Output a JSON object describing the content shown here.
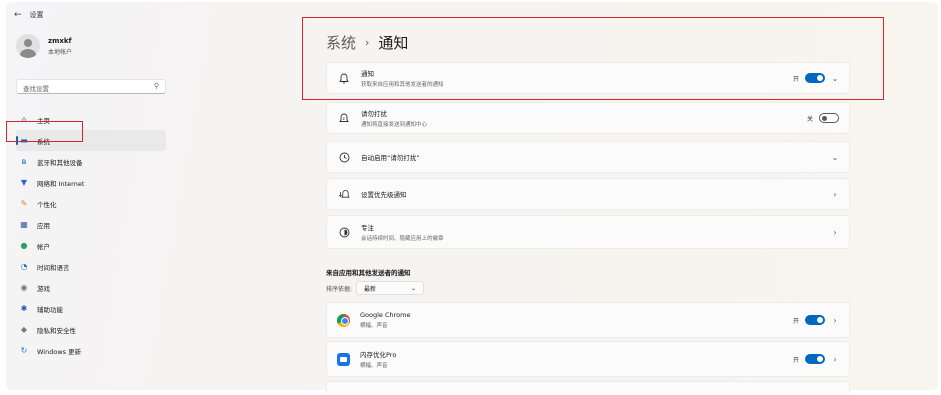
{
  "window": {
    "back": "←",
    "title": "设置"
  },
  "profile": {
    "name": "zmxkf",
    "account": "本地帐户"
  },
  "search": {
    "placeholder": "查找设置",
    "icon": "search-icon"
  },
  "sidebar": {
    "items": [
      {
        "label": "主页",
        "icon": "home-icon",
        "glyph": "⌂",
        "color": "#555555",
        "active": false
      },
      {
        "label": "系统",
        "icon": "monitor-icon",
        "glyph": "▬",
        "color": "#0067c0",
        "active": true
      },
      {
        "label": "蓝牙和其他设备",
        "icon": "bluetooth-icon",
        "glyph": "ʙ",
        "color": "#0067c0",
        "active": false
      },
      {
        "label": "网络和 Internet",
        "icon": "wifi-icon",
        "glyph": "▼",
        "color": "#2a6ac8",
        "active": false
      },
      {
        "label": "个性化",
        "icon": "brush-icon",
        "glyph": "✎",
        "color": "#d9822b",
        "active": false
      },
      {
        "label": "应用",
        "icon": "apps-icon",
        "glyph": "▦",
        "color": "#3a5a9a",
        "active": false
      },
      {
        "label": "帐户",
        "icon": "account-icon",
        "glyph": "●",
        "color": "#2aa063",
        "active": false
      },
      {
        "label": "时间和语言",
        "icon": "clock-globe-icon",
        "glyph": "◔",
        "color": "#1f7ac6",
        "active": false
      },
      {
        "label": "游戏",
        "icon": "gamepad-icon",
        "glyph": "◉",
        "color": "#6a7a8a",
        "active": false
      },
      {
        "label": "辅助功能",
        "icon": "accessibility-icon",
        "glyph": "✱",
        "color": "#1f5ab0",
        "active": false
      },
      {
        "label": "隐私和安全性",
        "icon": "shield-icon",
        "glyph": "◆",
        "color": "#7a7a7a",
        "active": false
      },
      {
        "label": "Windows 更新",
        "icon": "update-icon",
        "glyph": "↻",
        "color": "#1f72c8",
        "active": false
      }
    ]
  },
  "breadcrumb": {
    "parent": "系统",
    "sep": "›",
    "current": "通知"
  },
  "cards": {
    "notifications": {
      "title": "通知",
      "subtitle": "获取来自应用和其他发送者的通知",
      "state": "开",
      "icon": "bell-icon",
      "toggle": true
    },
    "dnd": {
      "title": "请勿打扰",
      "subtitle": "通知将直接发送到通知中心",
      "state": "关",
      "icon": "bell-moon-icon",
      "toggle": false
    },
    "auto_dnd": {
      "title": "自动启用“请勿打扰”",
      "icon": "clock-icon"
    },
    "priority": {
      "title": "设置优先级通知",
      "icon": "bell-priority-icon"
    },
    "focus": {
      "title": "专注",
      "subtitle": "会话持续时间、隐藏应用上的徽章",
      "icon": "focus-icon"
    }
  },
  "section": {
    "title": "来自应用和其他发送者的通知"
  },
  "sort": {
    "label": "排序依据:",
    "value": "最新"
  },
  "apps": [
    {
      "name": "Google Chrome",
      "detail": "横幅、声音",
      "state": "开",
      "icon": "chrome-icon"
    },
    {
      "name": "内存优化Pro",
      "detail": "横幅、声音",
      "state": "开",
      "icon": "memory-app-icon"
    }
  ],
  "colors": {
    "accent": "#0067c0",
    "highlight": "#d6262a"
  }
}
